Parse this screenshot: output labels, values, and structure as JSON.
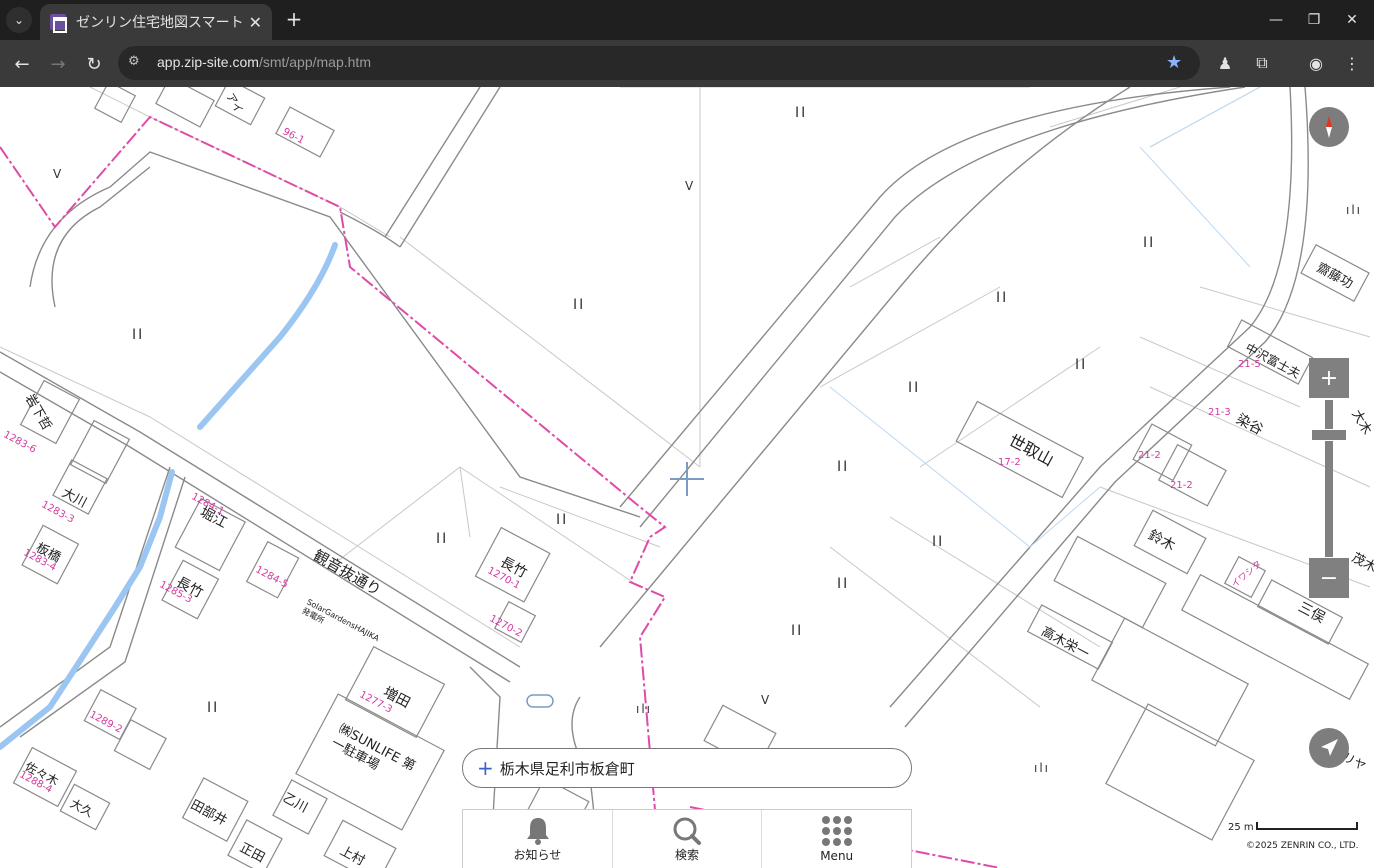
{
  "browser": {
    "tab": {
      "title": "ゼンリン住宅地図スマートフォン"
    },
    "url": {
      "host": "app.zip-site.com",
      "path": "/smt/app/map.htm"
    }
  },
  "map": {
    "labels": {
      "road_kannon": "観音抜通り",
      "setoriyama": "世取山",
      "nakazawa": "中沢富士夫",
      "saitou": "齋藤功",
      "someya": "染谷",
      "suzuki": "鈴木",
      "takagi": "高木栄一",
      "mitsumata": "三俣",
      "nagatake1": "長竹",
      "nagatake2": "長竹",
      "horie": "堀江",
      "masuda": "増田",
      "sunlife": "㈱SUNLIFE 第一駐車場",
      "ookawa": "大川",
      "itahashi": "板橋",
      "iwashita": "岩下哲",
      "otogawa": "乙川",
      "tabebe": "田部井",
      "shouda": "正田",
      "kamimura": "上村",
      "sasaki": "佐々木",
      "ookubo": "大久",
      "solar": "SolarGardensHAJIKA 発電所",
      "iwasaki": "イワシタ",
      "ai": "アイ",
      "yoshida": "ヨトリヤ",
      "moshi": "茂木",
      "ookimura": "大木"
    },
    "lot_numbers": {
      "n1": "17-2",
      "n2": "21-5",
      "n3": "21-3",
      "n4": "21-2",
      "n5": "21-2",
      "n6": "1283-6",
      "n7": "1283-3",
      "n8": "1283-4",
      "n9": "1284-1",
      "n10": "1284-5",
      "n11": "1285-3",
      "n12": "1270-1",
      "n13": "1270-2",
      "n14": "1277-3",
      "n15": "96-1",
      "n16": "1289-2",
      "n17": "1288-4"
    },
    "symbols": {
      "field": "II",
      "wasteland": "V",
      "orchard": "ılı"
    },
    "search": {
      "address": "栃木県足利市板倉町"
    },
    "menu": [
      {
        "label": "お知らせ",
        "icon": "bell-icon"
      },
      {
        "label": "検索",
        "icon": "search-icon"
      },
      {
        "label": "Menu",
        "icon": "grid-icon"
      }
    ],
    "scale": {
      "label": "25 m"
    },
    "copyright": "©2025 ZENRIN CO., LTD."
  },
  "colors": {
    "boundary": "#e04aa8",
    "water": "#9cc6f2",
    "accent": "#3a62c4"
  }
}
